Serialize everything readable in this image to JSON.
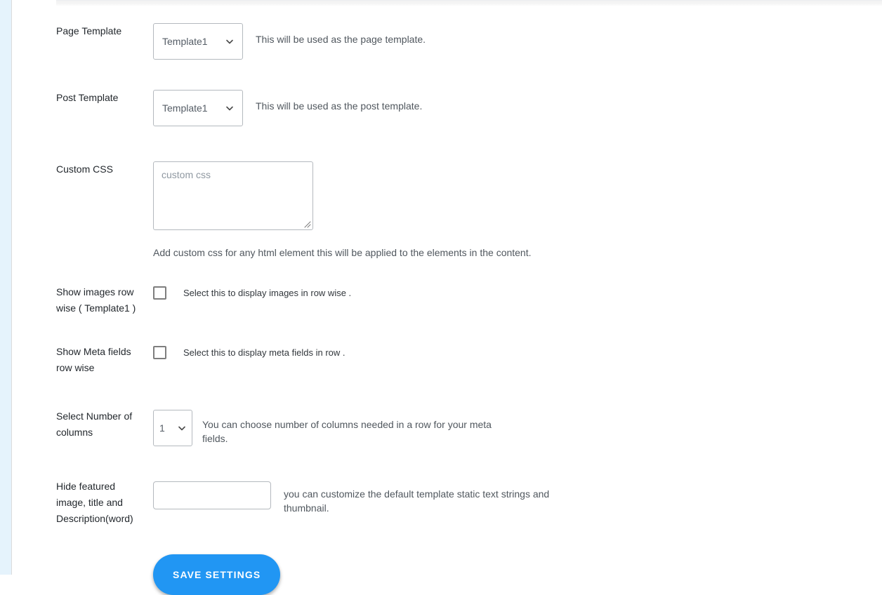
{
  "rows": [
    {
      "label": "Page Template",
      "control": "select",
      "value": "Template1",
      "description": "This will be used as the page template."
    },
    {
      "label": "Post Template",
      "control": "select",
      "value": "Template1",
      "description": "This will be used as the post template."
    },
    {
      "label": "Custom CSS",
      "control": "textarea",
      "value": "",
      "placeholder": "custom css",
      "helper": "Add custom css for any html element this will be applied to the elements in the content."
    },
    {
      "label": "Show images row wise ( Template1 )",
      "control": "checkbox",
      "checked": false,
      "checkbox_text": "Select this to display images in row wise ."
    },
    {
      "label": "Show Meta fields row wise",
      "control": "checkbox",
      "checked": false,
      "checkbox_text": "Select this to display meta fields in row ."
    },
    {
      "label": "Select Number of columns",
      "control": "select-narrow",
      "value": "1",
      "description": "You can choose number of columns needed in a row for your meta fields."
    },
    {
      "label": "Hide featured image, title and Description(word)",
      "control": "text",
      "value": "",
      "placeholder": "",
      "description": "you can customize the default template static text strings and thumbnail."
    }
  ],
  "submit": {
    "label": "SAVE SETTINGS",
    "accent_color": "#2196f3"
  },
  "icons": {
    "chevron_down": "chevron-down-icon",
    "resize_grip": "resize-grip-icon"
  },
  "colors": {
    "accent": "#2196f3",
    "label_text": "#23282d",
    "description_text": "#50575e",
    "field_border": "#b4b9be",
    "rail": "#e5f3fc"
  }
}
